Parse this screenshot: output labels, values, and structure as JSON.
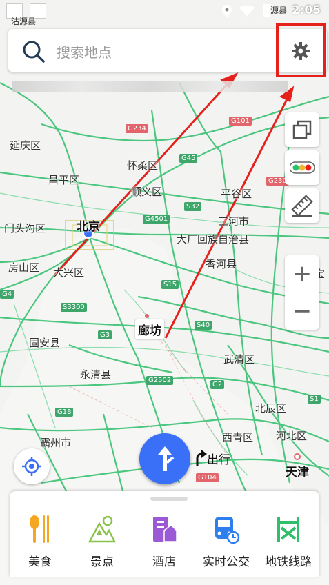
{
  "status_bar": {
    "left_label": "沽源县",
    "right_label": "古源县",
    "time": "2:05"
  },
  "search": {
    "placeholder": "搜索地点"
  },
  "map": {
    "labels": [
      "延庆区",
      "怀柔区",
      "昌平区",
      "顺义区",
      "平谷区",
      "门头沟区",
      "北京",
      "三河市",
      "大厂回族自治县",
      "房山区",
      "大兴区",
      "香河县",
      "廊坊",
      "固安县",
      "永清县",
      "武清区",
      "霸州市",
      "北辰区",
      "西青区",
      "河北区",
      "天津",
      "宝"
    ],
    "shields": [
      "G234",
      "G101",
      "G45",
      "G230",
      "S32",
      "G4501",
      "S15",
      "S3300",
      "G3",
      "S40",
      "G2502",
      "G2",
      "G18",
      "S1",
      "G104",
      "G4"
    ]
  },
  "travel": {
    "label": "出行"
  },
  "bottom_nav": {
    "items": [
      {
        "label": "美食",
        "icon": "food-icon"
      },
      {
        "label": "景点",
        "icon": "scenic-icon"
      },
      {
        "label": "酒店",
        "icon": "hotel-icon"
      },
      {
        "label": "实时公交",
        "icon": "bus-icon"
      },
      {
        "label": "地铁线路",
        "icon": "metro-icon"
      }
    ]
  },
  "colors": {
    "accent_blue": "#3a6ff7",
    "annotation_red": "#e6211c",
    "road_green": "#2fbf6b"
  }
}
